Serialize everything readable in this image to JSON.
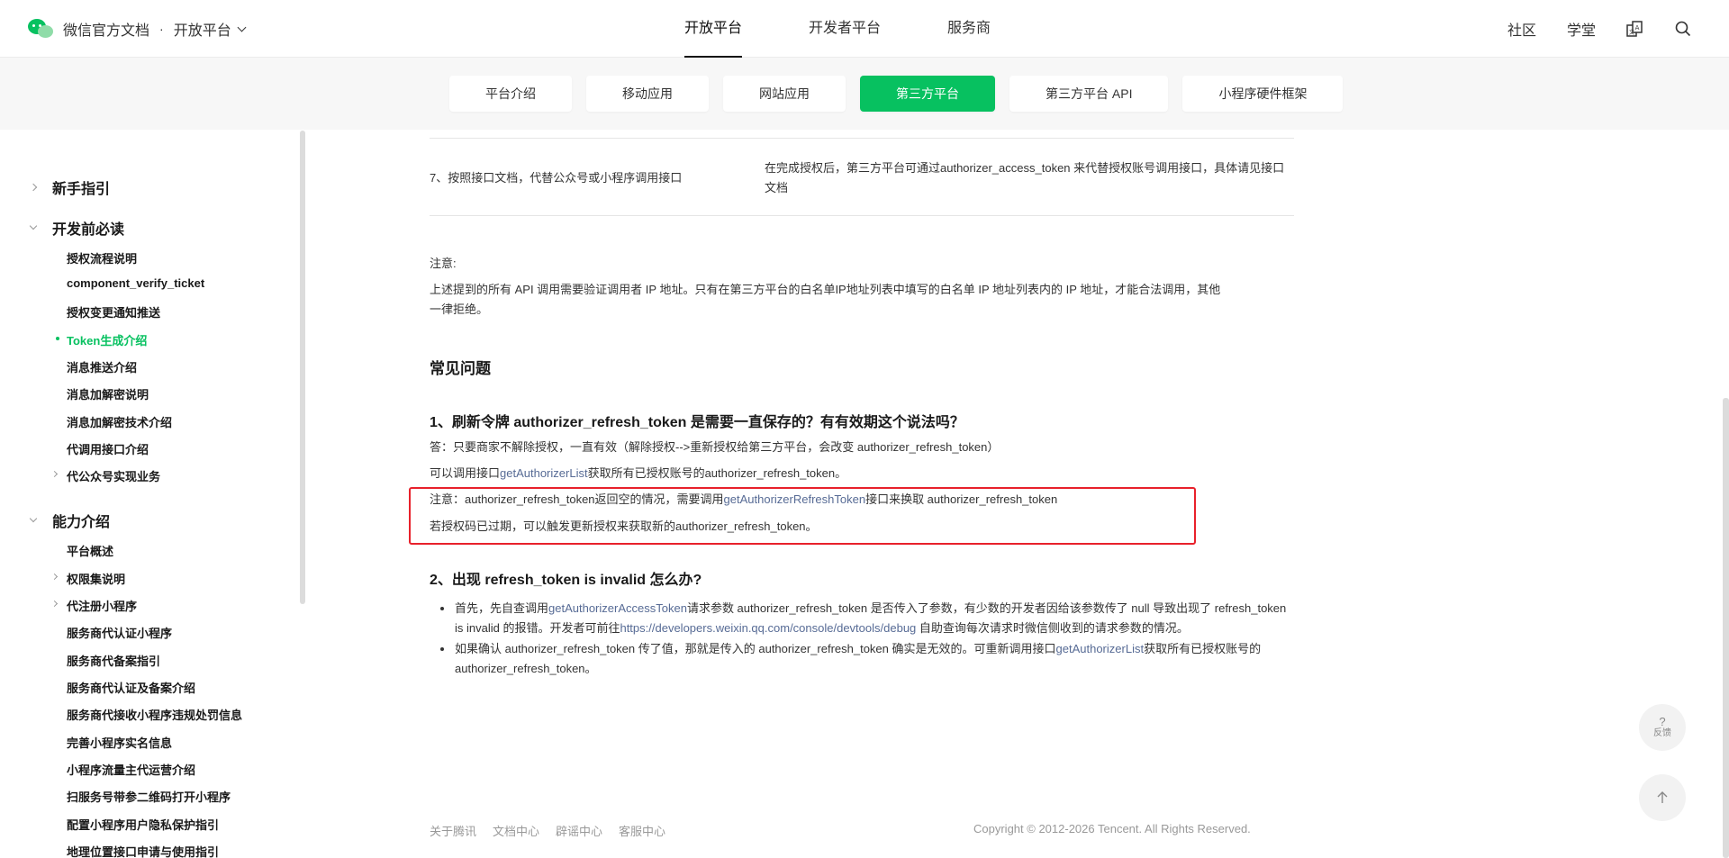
{
  "header": {
    "brand_title": "微信官方文档",
    "brand_dot": "·",
    "platform": "开放平台",
    "main_tabs": [
      {
        "label": "开放平台",
        "active": true
      },
      {
        "label": "开发者平台",
        "active": false
      },
      {
        "label": "服务商",
        "active": false
      }
    ],
    "right_links": [
      "社区",
      "学堂"
    ],
    "icons": [
      "translate-icon",
      "search-icon"
    ]
  },
  "subnav": {
    "tabs": [
      {
        "label": "平台介绍",
        "active": false
      },
      {
        "label": "移动应用",
        "active": false
      },
      {
        "label": "网站应用",
        "active": false
      },
      {
        "label": "第三方平台",
        "active": true
      },
      {
        "label": "第三方平台 API",
        "active": false
      },
      {
        "label": "小程序硬件框架",
        "active": false
      }
    ]
  },
  "sidebar": {
    "groups": [
      {
        "label": "新手指引",
        "expanded": false
      },
      {
        "label": "开发前必读",
        "expanded": true
      },
      {
        "label": "能力介绍",
        "expanded": true
      }
    ],
    "items_dev": [
      "授权流程说明",
      "component_verify_ticket",
      "授权变更通知推送",
      "Token生成介绍",
      "消息推送介绍",
      "消息加解密说明",
      "消息加解密技术介绍",
      "代调用接口介绍",
      "代公众号实现业务"
    ],
    "items_ability": [
      "平台概述",
      "权限集说明",
      "代注册小程序",
      "服务商代认证小程序",
      "服务商代备案指引",
      "服务商代认证及备案介绍",
      "服务商代接收小程序违规处罚信息",
      "完善小程序实名信息",
      "小程序流量主代运营介绍",
      "扫服务号带参二维码打开小程序",
      "配置小程序用户隐私保护指引",
      "地理位置接口申请与使用指引"
    ],
    "active_item": "Token生成介绍"
  },
  "content": {
    "table_row": {
      "step": "7、按照接口文档，代替公众号或小程序调用接口",
      "desc": "在完成授权后，第三方平台可通过authorizer_access_token 来代替授权账号调用接口，具体请见接口文档"
    },
    "note_title": "注意:",
    "note_text_1": "上述提到的所有 API 调用需要验证调用者 IP 地址。只有在第三方平台的白名单IP地址列表中填写的白名单 IP 地址列表内的 IP 地址，才能合法调用，其他",
    "note_text_2": "一律拒绝。",
    "faq_title": "常见问题",
    "q1_title": "1、刷新令牌 authorizer_refresh_token 是需要一直保存的？有有效期这个说法吗？",
    "q1_answer": "答：只要商家不解除授权，一直有效（解除授权-->重新授权给第三方平台，会改变 authorizer_refresh_token）",
    "q1_line2_pre": "可以调用接口",
    "q1_line2_link": "getAuthorizerList",
    "q1_line2_post": "获取所有已授权账号的authorizer_refresh_token。",
    "q1_note_pre": "注意：authorizer_refresh_token返回空的情况，需要调用",
    "q1_note_link": "getAuthorizerRefreshToken",
    "q1_note_post": "接口来换取 authorizer_refresh_token",
    "q1_note_line2": "若授权码已过期，可以触发更新授权来获取新的authorizer_refresh_token。",
    "q2_title": "2、出现 refresh_token is invalid 怎么办?",
    "q2_b1_pre": "首先，先自查调用",
    "q2_b1_link": "getAuthorizerAccessToken",
    "q2_b1_mid": "请求参数 authorizer_refresh_token 是否传入了参数，有少数的开发者因给该参数传了 null 导致出现了 refresh_token is invalid 的报错。开发者可前往",
    "q2_b1_link2": "https://developers.weixin.qq.com/console/devtools/debug",
    "q2_b1_post": " 自助查询每次请求时微信侧收到的请求参数的情况。",
    "q2_b2_pre": "如果确认 authorizer_refresh_token 传了值，那就是传入的 authorizer_refresh_token 确实是无效的。可重新调用接口",
    "q2_b2_link": "getAuthorizerList",
    "q2_b2_post": "获取所有已授权账号的 authorizer_refresh_token。"
  },
  "footer": {
    "links": [
      "关于腾讯",
      "文档中心",
      "辟谣中心",
      "客服中心"
    ],
    "copyright": "Copyright © 2012-2026 Tencent. All Rights Reserved."
  },
  "floating": {
    "feedback_q": "?",
    "feedback_label": "反馈"
  },
  "colors": {
    "accent": "#07c160",
    "link": "#576b95",
    "highlight_border": "#e8212b"
  }
}
